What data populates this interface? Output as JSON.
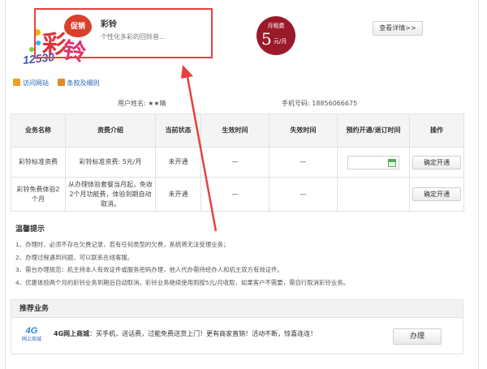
{
  "product": {
    "promo_badge": "促销",
    "title": "彩铃",
    "description": "个性化多彩的回铃音...",
    "price_label": "月租费",
    "price_value": "5",
    "price_unit": "元/月",
    "detail_button": "查看详情>>"
  },
  "logo": {
    "text_char1": "彩",
    "text_char2": "铃",
    "number": "12530"
  },
  "links": [
    {
      "label": "访问网站",
      "icon": "globe-icon"
    },
    {
      "label": "条款及细则",
      "icon": "document-icon"
    }
  ],
  "user": {
    "name_label": "用户姓名:",
    "name_value": "★★睛",
    "phone_label": "手机号码:",
    "phone_value": "18856066675"
  },
  "table": {
    "headers": [
      "业务名称",
      "资费介绍",
      "当前状态",
      "生效时间",
      "失效时间",
      "预约开通/退订时间",
      "操作"
    ],
    "rows": [
      {
        "name": "彩铃标准资费",
        "fee": "彩铃标准资费: 5元/月",
        "status": "未开通",
        "start": "—",
        "end": "—",
        "has_date_input": true,
        "action": "确定开通"
      },
      {
        "name": "彩铃免费体验2个月",
        "fee": "从办理体验套餐当月起，免收2个月功能费，体验到期自动取消。",
        "status": "未开通",
        "start": "—",
        "end": "—",
        "has_date_input": false,
        "action": "确定开通"
      }
    ]
  },
  "tips": {
    "title": "温馨提示",
    "items": [
      "1、办理时，必须不存在欠费记录，若有任何类型的欠费，系统将无法受理业务；",
      "2、办理过程遇到问题，可以联系在线客服。",
      "3、需台办理规范：机主持本人有效证件或服务密码办理，他人代办需持经办人和机主双方有效证件。",
      "4、优惠体验两个月的彩铃业务到期后自动取消。彩铃业务继续使用则按5元/月收取，如果客户不需要，需自行取消彩铃业务。"
    ]
  },
  "recommend": {
    "title": "推荐业务",
    "logo_main": "4G",
    "logo_sub": "网上商城",
    "text_bold": "4G网上商城",
    "text": "：买手机，送话费，过能免费送货上门！更有商家直销！活动不断，惊喜连连！",
    "button": "办理"
  },
  "colors": {
    "highlight_red": "#e84040",
    "price_circle": "#9a1a2a",
    "link_blue": "#2a66b8"
  }
}
